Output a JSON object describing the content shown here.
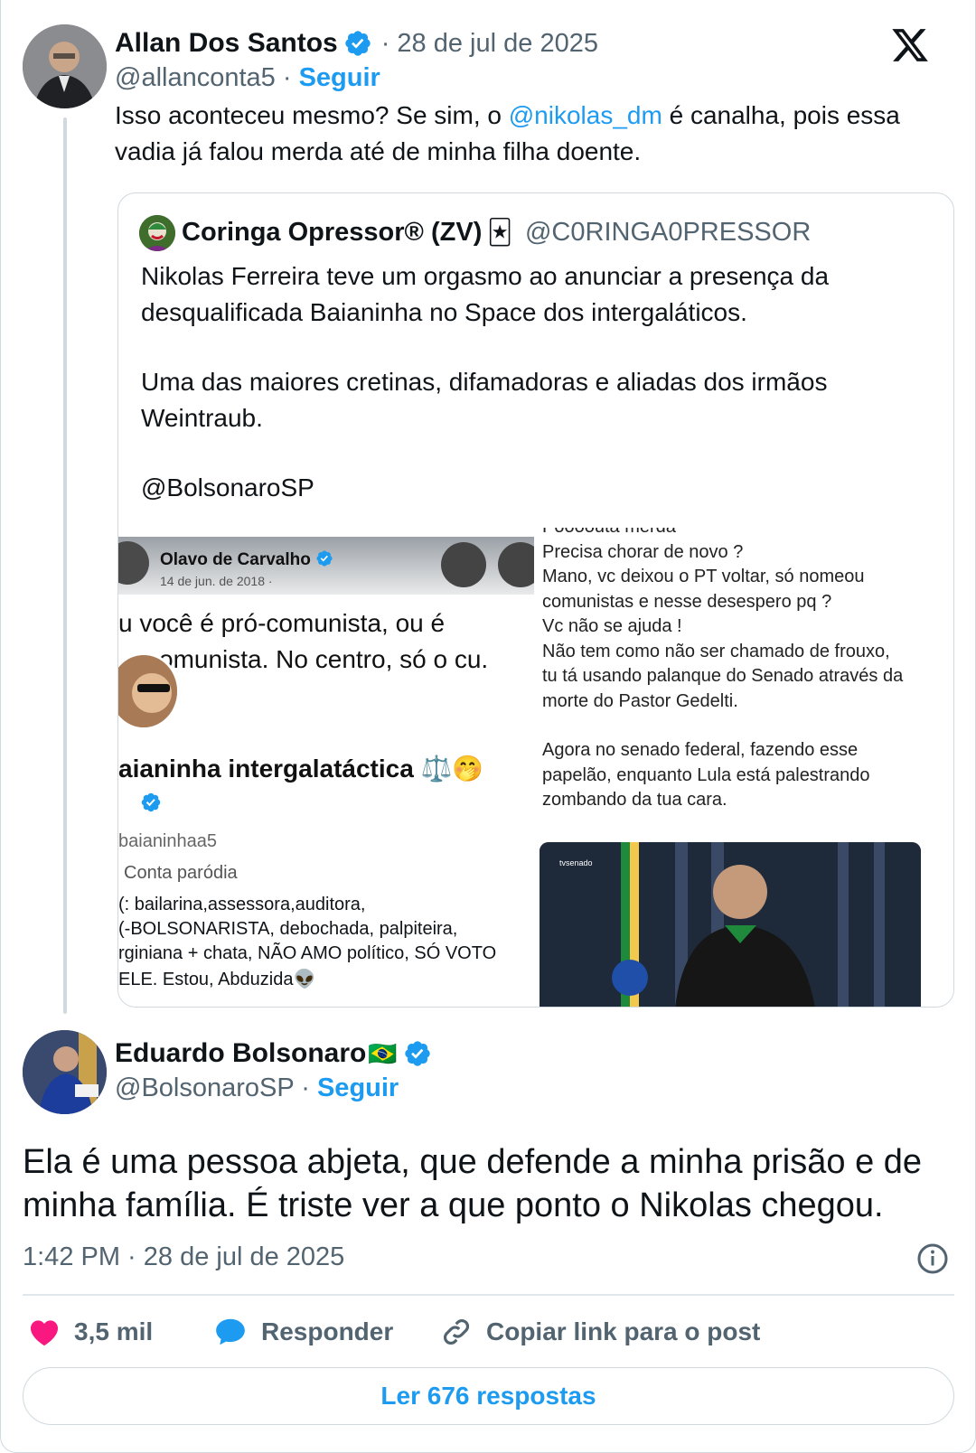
{
  "colors": {
    "accent": "#1d9bf0",
    "muted": "#536471",
    "like": "#f91880",
    "text": "#0f1419"
  },
  "parent_tweet": {
    "author_name": "Allan Dos Santos",
    "date": "· 28 de jul de 2025",
    "handle": "@allanconta5",
    "separator": " · ",
    "follow_label": "Seguir",
    "text_before_mention": "Isso aconteceu mesmo? Se sim, o ",
    "mention": "@nikolas_dm",
    "text_after_mention": " é canalha, pois essa vadia já falou merda até de minha filha doente."
  },
  "quoted_tweet": {
    "author_name": "Coringa Opressor® (ZV)",
    "emoji": "🃏",
    "handle": "@C0RINGA0PRESSOR",
    "paragraph_1": "Nikolas Ferreira teve um orgasmo ao anunciar a presença da desqualificada Baianinha no Space dos intergaláticos.",
    "paragraph_2": "Uma das maiores cretinas, difamadoras e aliadas dos irmãos Weintraub.",
    "paragraph_3": "@BolsonaroSP",
    "media_left": {
      "header_name": "Olavo de Carvalho",
      "header_date": "14 de jun. de 2018 ·",
      "quote_line_1": "u você é pró-comunista, ou é",
      "quote_line_2": "omunista. No centro, só o cu.",
      "profile_name": "aianinha intergalatáctica ⚖️🤭",
      "profile_handle": "baianinhaa5",
      "profile_parody": "Conta paródia",
      "bio_line_1": "(: bailarina,assessora,auditora,",
      "bio_line_2": "(-BOLSONARISTA, debochada, palpiteira,",
      "bio_line_3": "rginiana + chata, NÃO AMO político, SÓ VOTO",
      "bio_line_4": "ELE. Estou, Abduzida👽"
    },
    "media_right": {
      "line_0": "Poooouta merda",
      "line_1": "Precisa chorar de novo ?",
      "line_2": "Mano, vc deixou o PT voltar, só nomeou",
      "line_3": "comunistas e nesse desespero pq ?",
      "line_4": "Vc não se ajuda !",
      "line_5": "Não tem como não ser chamado de frouxo,",
      "line_6": "tu tá usando palanque do Senado através da",
      "line_7": "morte do Pastor Gedelti.",
      "line_8": "Agora no senado federal, fazendo esse",
      "line_9": "papelão, enquanto Lula está palestrando",
      "line_10": "zombando da tua cara.",
      "tv_logo": "tvsenado ao vivo"
    }
  },
  "main_tweet": {
    "author_name": "Eduardo Bolsonaro",
    "flag": "🇧🇷",
    "handle": "@BolsonaroSP",
    "separator": " · ",
    "follow_label": "Seguir",
    "text": "Ela é uma pessoa abjeta, que defende a minha prisão e de minha família. É triste ver a que ponto o Nikolas chegou.",
    "timestamp": "1:42 PM · 28 de jul de 2025"
  },
  "actions": {
    "likes": "3,5 mil",
    "reply_label": "Responder",
    "copy_label": "Copiar link para o post"
  },
  "read_replies_label": "Ler 676 respostas"
}
